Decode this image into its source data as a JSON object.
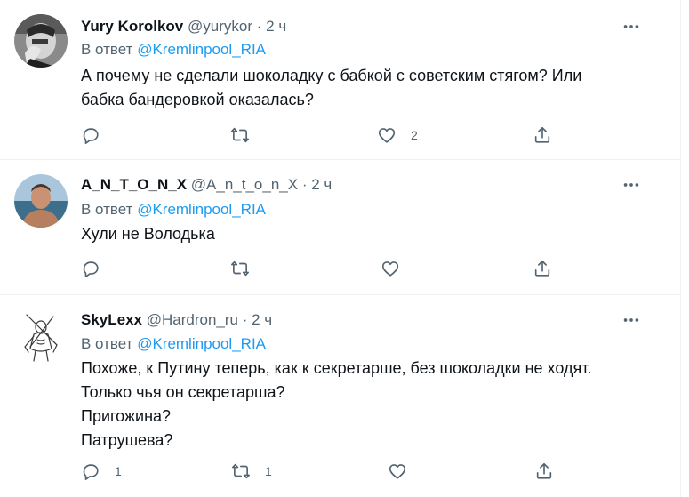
{
  "colors": {
    "link": "#1d9bf0",
    "secondary_text": "#536471",
    "primary_text": "#0f1419",
    "divider": "#eff3f4"
  },
  "icons": {
    "more": "more-horizontal-icon",
    "reply": "reply-icon",
    "retweet": "retweet-icon",
    "like": "heart-icon",
    "share": "share-icon"
  },
  "tweets": [
    {
      "name": "Yury Korolkov",
      "handle": "@yurykor",
      "sep": "·",
      "time": "2 ч",
      "reply_prefix": "В ответ",
      "reply_to": "@Kremlinpool_RIA",
      "lines": [
        "А почему не сделали шоколадку с бабкой с советским стягом? Или",
        "бабка бандеровкой оказалась?"
      ],
      "counts": {
        "reply": "",
        "retweet": "",
        "like": "2"
      }
    },
    {
      "name": "A_N_T_O_N_X",
      "handle": "@A_n_t_o_n_X",
      "sep": "·",
      "time": "2 ч",
      "reply_prefix": "В ответ",
      "reply_to": "@Kremlinpool_RIA",
      "lines": [
        "Хули не Володька"
      ],
      "counts": {
        "reply": "",
        "retweet": "",
        "like": ""
      }
    },
    {
      "name": "SkyLexx",
      "handle": "@Hardron_ru",
      "sep": "·",
      "time": "2 ч",
      "reply_prefix": "В ответ",
      "reply_to": "@Kremlinpool_RIA",
      "lines": [
        "Похоже, к Путину теперь, как к секретарше, без шоколадки не ходят.",
        "Только чья он секретарша?",
        "Пригожина?",
        "Патрушева?"
      ],
      "counts": {
        "reply": "1",
        "retweet": "1",
        "like": ""
      }
    }
  ]
}
